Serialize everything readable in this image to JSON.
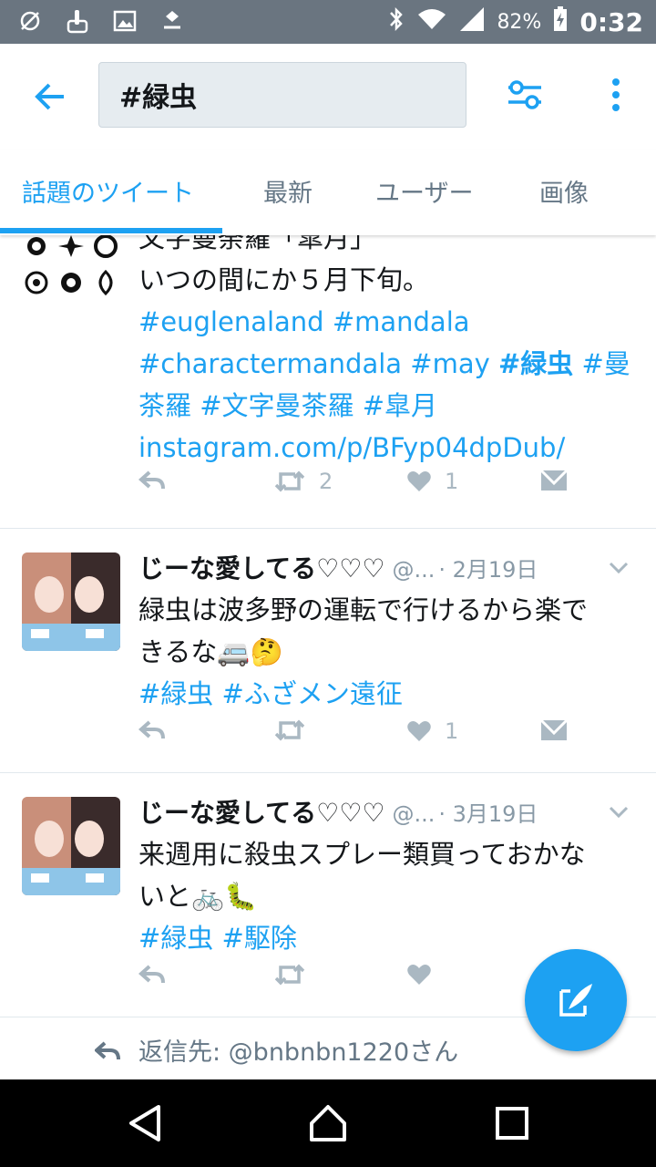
{
  "status_bar": {
    "battery_percent": "82%",
    "time": "0:32",
    "icons": [
      "missed-call-icon",
      "touch-icon",
      "image-icon",
      "download-icon",
      "bluetooth-icon",
      "wifi-icon",
      "signal-icon",
      "battery-icon"
    ]
  },
  "header": {
    "search_query": "#緑虫"
  },
  "tabs": [
    {
      "label": "話題のツイート",
      "active": true
    },
    {
      "label": "最新",
      "active": false
    },
    {
      "label": "ユーザー",
      "active": false
    },
    {
      "label": "画像",
      "active": false
    }
  ],
  "tweets": [
    {
      "lines": [
        "文字曼荼羅「皐月」",
        "いつの間にか５月下旬。"
      ],
      "hashtags_line1": "#euglenaland #mandala",
      "hashtags_line2a": "#charactermandala #may ",
      "hashtags_line2b": "#緑虫",
      "hashtags_line2c": " #曼",
      "hashtags_line3": "茶羅 #文字曼茶羅 #皐月",
      "link": "instagram.com/p/BFyp04dpDub/",
      "retweets": "2",
      "likes": "1"
    },
    {
      "name": "じーな愛してる♡♡♡",
      "handle": "@...",
      "date": "· 2月19日",
      "text_line1": "緑虫は波多野の運転で行けるから楽で",
      "text_line2": "きるな",
      "emoji": "🚐🤔",
      "hashtags": "#緑虫 #ふざメン遠征",
      "retweets": "",
      "likes": "1"
    },
    {
      "name": "じーな愛してる♡♡♡",
      "handle": "@...",
      "date": "· 3月19日",
      "text_line1": "来週用に殺虫スプレー類買っておかな",
      "text_line2": "いと",
      "emoji": "🚲🐛",
      "hashtags": "#緑虫 #駆除",
      "retweets": "",
      "likes": ""
    }
  ],
  "reply_bar": {
    "label": "返信先",
    "target": ": @bnbnbn1220さん"
  },
  "colors": {
    "accent": "#1da1f2",
    "status_bar": "#6a7580",
    "muted": "#657786",
    "icon_gray": "#aab8c2"
  }
}
